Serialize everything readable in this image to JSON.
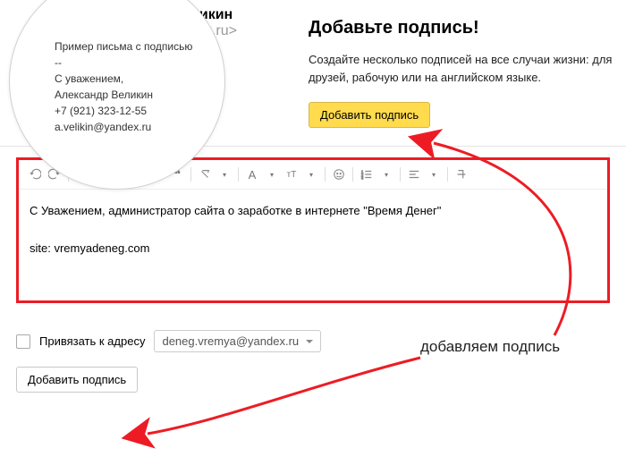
{
  "sender": {
    "name": "Александр Великин",
    "email": "<a.velikin@yandex.ru>"
  },
  "preview": {
    "subject": "Пример письма с подписью",
    "sep": "--",
    "l1": "С уважением,",
    "l2": "Александр Великин",
    "l3": "+7 (921) 323-12-55",
    "l4": "a.velikin@yandex.ru"
  },
  "promo": {
    "heading": "Добавьте подпись!",
    "desc": "Создайте несколько подписей на все случаи жизни: для друзей, рабочую или на английском языке.",
    "button": "Добавить подпись"
  },
  "editor": {
    "line1": "С Уважением, администратор сайта о заработке в интернете \"Время Денег\"",
    "line2": "site: vremyadeneg.com"
  },
  "bind": {
    "label": "Привязать к адресу",
    "value": "deneg.vremya@yandex.ru"
  },
  "add_button": "Добавить подпись",
  "annotation": "добавляем подпись"
}
